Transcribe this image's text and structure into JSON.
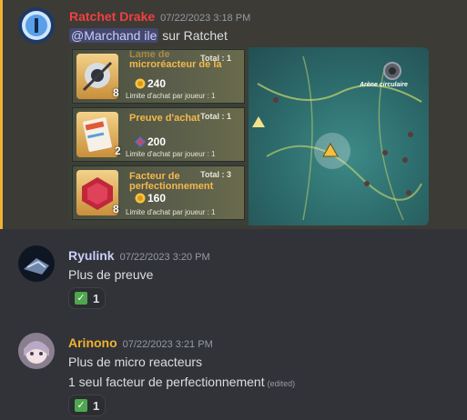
{
  "messages": [
    {
      "author": "Ratchet Drake",
      "author_color": "#f23f43",
      "timestamp": "07/22/2023 3:18 PM",
      "mention": "@Marchand ile",
      "text": " sur Ratchet",
      "attachment": {
        "shop_items": [
          {
            "name": "microréacteur de la",
            "name_top": "Lame de",
            "price": "240",
            "total": "Total : 1",
            "qty": "8",
            "limit": "Limite d'achat par joueur : 1",
            "currency": "gold-coin-icon"
          },
          {
            "name": "Preuve d'achat",
            "price": "200",
            "total": "Total : 1",
            "qty": "2",
            "limit": "Limite d'achat par joueur : 1",
            "currency": "blue-gem-icon"
          },
          {
            "name": "Facteur de perfectionnement",
            "price": "160",
            "total": "Total : 3",
            "qty": "8",
            "limit": "Limite d'achat par joueur : 1",
            "currency": "gold-coin-icon"
          }
        ],
        "map_label": "Arène circulaire"
      }
    },
    {
      "author": "Ryulink",
      "author_color": "#c9cdfb",
      "timestamp": "07/22/2023 3:20 PM",
      "lines": [
        "Plus de preuve"
      ],
      "reaction": {
        "emoji": "check-mark-icon",
        "count": "1"
      }
    },
    {
      "author": "Arinono",
      "author_color": "#f0b232",
      "timestamp": "07/22/2023 3:21 PM",
      "lines": [
        "Plus de micro reacteurs",
        "1 seul facteur de perfectionnement"
      ],
      "edited": "(edited)",
      "reaction": {
        "emoji": "check-mark-icon",
        "count": "1"
      }
    }
  ],
  "colors": {
    "background": "#313338",
    "highlight_bg": "#3c3b35",
    "highlight_border": "#f0b232"
  }
}
